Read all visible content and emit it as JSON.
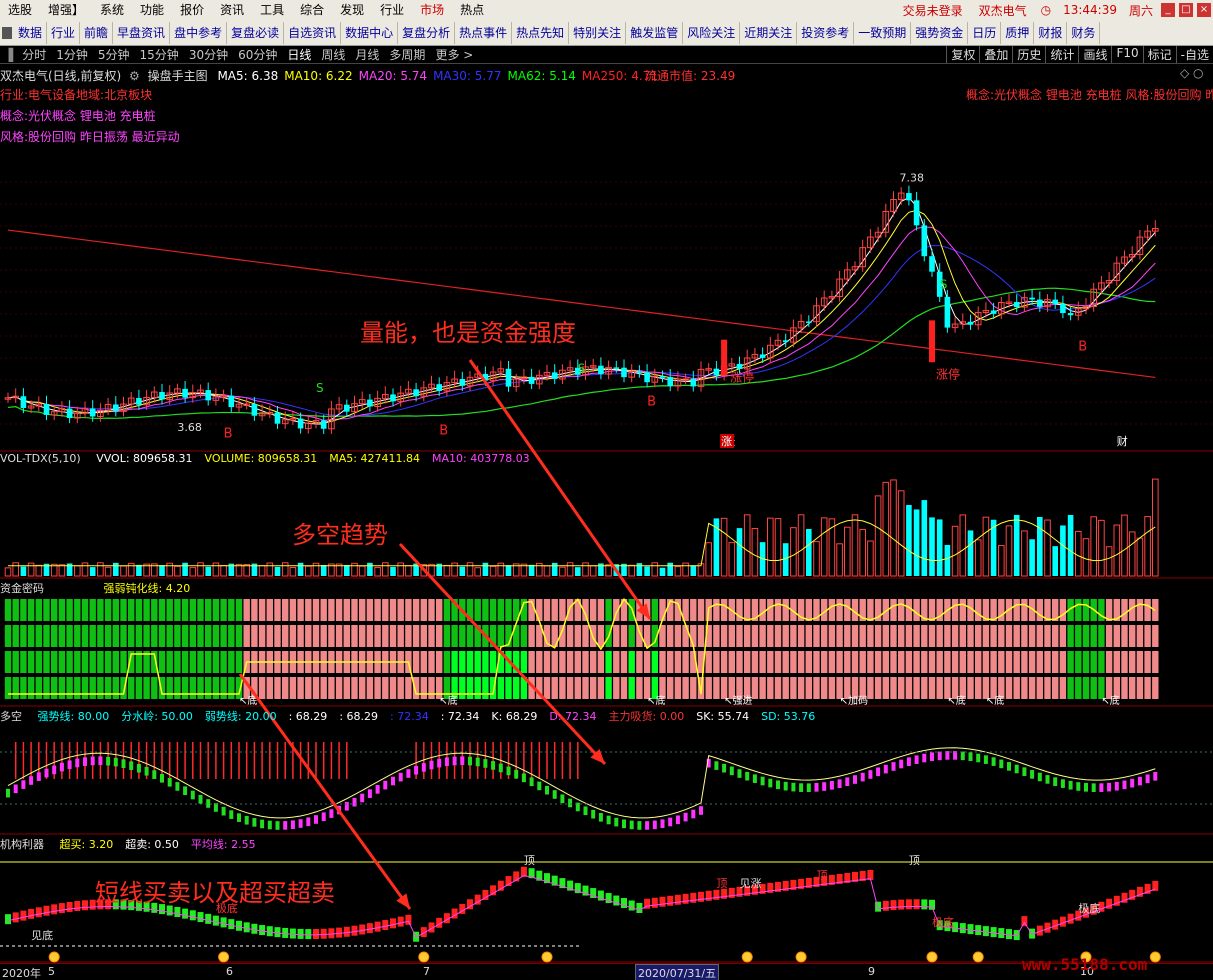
{
  "menu": {
    "items": [
      "选股",
      "增强】",
      "系统",
      "功能",
      "报价",
      "资讯",
      "工具",
      "综合",
      "发现",
      "行业",
      "市场",
      "热点"
    ],
    "active_item": "市场",
    "login_status": "交易未登录",
    "stock_name": "双杰电气",
    "clock": "13:44:39",
    "weekday": "周六"
  },
  "toolbar": {
    "items": [
      "数据",
      "行业",
      "前瞻",
      "早盘资讯",
      "盘中参考",
      "复盘必读",
      "自选资讯",
      "数据中心",
      "复盘分析",
      "热点事件",
      "热点先知",
      "特别关注",
      "触发监管",
      "风险关注",
      "近期关注",
      "投资参考",
      "一致预期",
      "强势资金",
      "日历",
      "质押",
      "财报",
      "财务"
    ]
  },
  "periods": {
    "items": [
      "分时",
      "1分钟",
      "5分钟",
      "15分钟",
      "30分钟",
      "60分钟",
      "日线",
      "周线",
      "月线",
      "多周期",
      "更多 >"
    ],
    "active": "日线",
    "right_buttons": [
      "复权",
      "叠加",
      "历史",
      "统计",
      "画线",
      "F10",
      "标记",
      "-自选"
    ]
  },
  "main_info": {
    "title": "双杰电气(日线,前复权)",
    "indicator_name": "操盘手主图",
    "ma": [
      {
        "label": "MA5: 6.38",
        "color": "#ffffff"
      },
      {
        "label": "MA10: 6.22",
        "color": "#ffff00"
      },
      {
        "label": "MA20: 5.74",
        "color": "#ff44ff"
      },
      {
        "label": "MA30: 5.77",
        "color": "#3333ff"
      },
      {
        "label": "MA62: 5.14",
        "color": "#00ff00"
      },
      {
        "label": "MA250: 4.71",
        "color": "#ff2222"
      }
    ],
    "float_cap": "流通市值: 23.49",
    "industry_line": "行业:电气设备地域:北京板块",
    "concept_line": "概念:光伏概念 锂电池 充电桩",
    "style_line": "风格:股份回购 昨日振荡 最近异动",
    "right_concept": "概念:光伏概念 锂电池 充电桩 风格:股份回购 昨"
  },
  "main_marks": {
    "high_label": "7.38",
    "low_label": "3.68",
    "buy": "B",
    "sell": "S",
    "zhangting": "涨停",
    "zhang": "涨",
    "cai": "财"
  },
  "vol_info": {
    "name": "VOL-TDX(5,10)",
    "items": [
      {
        "label": "VVOL: 809658.31",
        "color": "#ffffff"
      },
      {
        "label": "VOLUME: 809658.31",
        "color": "#ffff00"
      },
      {
        "label": "MA5: 427411.84",
        "color": "#ffff00"
      },
      {
        "label": "MA10: 403778.03",
        "color": "#ff44ff"
      }
    ]
  },
  "fund_info": {
    "name": "资金密码",
    "line_label": "强弱钝化线: 4.20",
    "marks": [
      "底",
      "底",
      "底",
      "强进",
      "加码",
      "底",
      "底",
      "底"
    ]
  },
  "duokong_info": {
    "name": "多空",
    "items": [
      {
        "label": "强势线: 80.00",
        "color": "#00ffff"
      },
      {
        "label": "分水岭: 50.00",
        "color": "#00ffff"
      },
      {
        "label": "弱势线: 20.00",
        "color": "#00ffff"
      },
      {
        "label": ": 68.29",
        "color": "#ffffff"
      },
      {
        "label": ": 68.29",
        "color": "#ffffff"
      },
      {
        "label": ": 72.34",
        "color": "#3333ff"
      },
      {
        "label": ": 72.34",
        "color": "#ffffff"
      },
      {
        "label": "K: 68.29",
        "color": "#ffffff"
      },
      {
        "label": "D: 72.34",
        "color": "#ff44ff"
      },
      {
        "label": "主力吸货: 0.00",
        "color": "#ff3333"
      },
      {
        "label": "SK: 55.74",
        "color": "#ffffff"
      },
      {
        "label": "SD: 53.76",
        "color": "#00ffff"
      }
    ]
  },
  "jigou_info": {
    "name": "机构利器",
    "items": [
      {
        "label": "超买: 3.20",
        "color": "#ffff00"
      },
      {
        "label": "超卖: 0.50",
        "color": "#ffffff"
      },
      {
        "label": "平均线: 2.55",
        "color": "#ff44ff"
      }
    ],
    "marks": [
      "见底",
      "极底",
      "顶",
      "顶",
      "见涨",
      "顶",
      "顶",
      "极底",
      "极底",
      "卖出",
      "卖出",
      "极底"
    ]
  },
  "annotations": {
    "a1": "量能，也是资金强度",
    "a2": "多空趋势",
    "a3": "短线买卖以及超买超卖"
  },
  "axis": {
    "labels": [
      "2020年",
      "5",
      "6",
      "7",
      "8",
      "9",
      "10"
    ],
    "selected_date": "2020/07/31/五"
  },
  "watermark": "www.55188.com",
  "colors": {
    "up": "#ff4444",
    "down": "#00ffff",
    "fund_red": "#f08a8a",
    "fund_green": "#0fbf14",
    "fund_green_bright": "#00ff22"
  },
  "chart_data": {
    "type": "candlestick",
    "title": "双杰电气(日线,前复权)",
    "price_labels": {
      "high": 7.38,
      "low": 3.68
    },
    "series": [
      {
        "name": "MA5",
        "last": 6.38
      },
      {
        "name": "MA10",
        "last": 6.22
      },
      {
        "name": "MA20",
        "last": 5.74
      },
      {
        "name": "MA30",
        "last": 5.77
      },
      {
        "name": "MA62",
        "last": 5.14
      },
      {
        "name": "MA250",
        "last": 4.71
      }
    ],
    "volume_last": 809658.31,
    "vol_ma5": 427411.84,
    "vol_ma10": 403778.03
  }
}
